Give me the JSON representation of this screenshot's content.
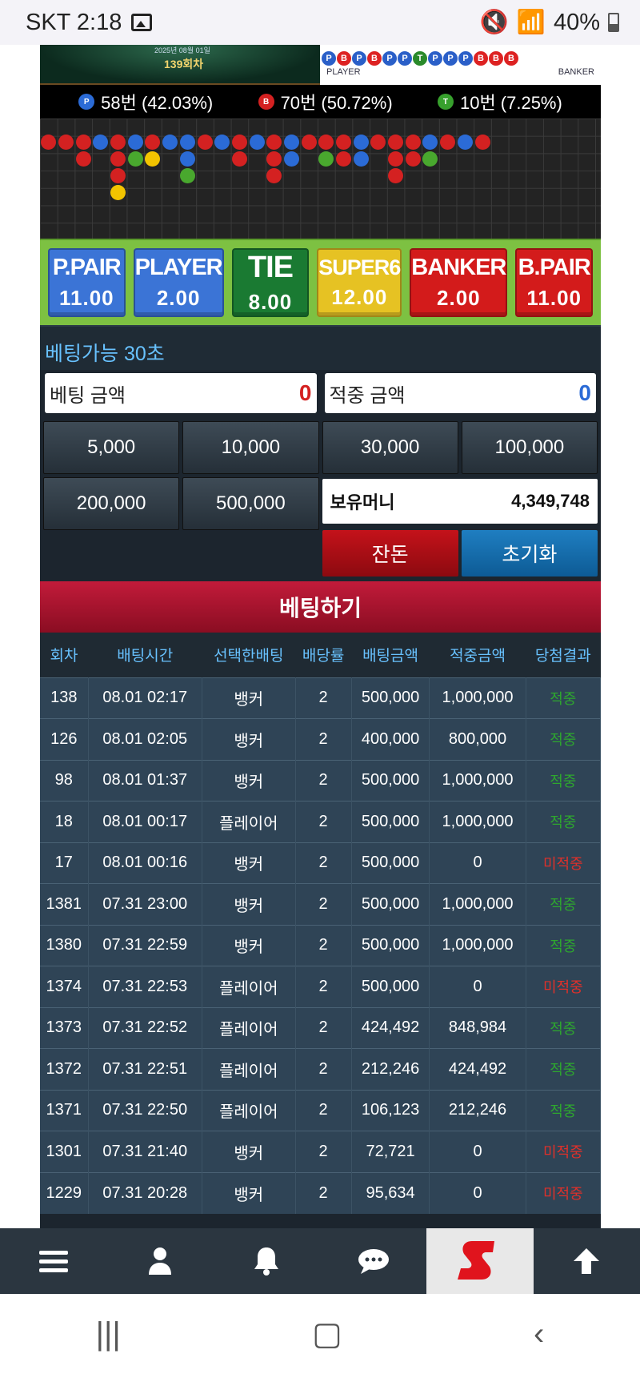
{
  "status": {
    "carrier_time": "SKT 2:18",
    "battery": "40%"
  },
  "game": {
    "date": "2025년 08월 01일",
    "round": "139회차",
    "legend_player": "PLAYER",
    "legend_banker": "BANKER"
  },
  "stats": {
    "p_count": "58번 (42.03%)",
    "b_count": "70번 (50.72%)",
    "t_count": "10번 (7.25%)",
    "p_label": "P",
    "b_label": "B",
    "t_label": "T"
  },
  "board": [
    {
      "name": "P.PAIR",
      "odds": "11.00"
    },
    {
      "name": "PLAYER",
      "odds": "2.00"
    },
    {
      "name": "TIE",
      "odds": "8.00"
    },
    {
      "name": "SUPER6",
      "odds": "12.00"
    },
    {
      "name": "BANKER",
      "odds": "2.00"
    },
    {
      "name": "B.PAIR",
      "odds": "11.00"
    }
  ],
  "bet": {
    "available": "베팅가능 30초",
    "amount_label": "베팅 금액",
    "amount_value": "0",
    "win_label": "적중 금액",
    "win_value": "0",
    "chips": [
      "5,000",
      "10,000",
      "30,000",
      "100,000",
      "200,000",
      "500,000"
    ],
    "money_label": "보유머니",
    "money_value": "4,349,748",
    "change_label": "잔돈",
    "reset_label": "초기화",
    "submit_label": "베팅하기"
  },
  "history": {
    "headers": [
      "회차",
      "배팅시간",
      "선택한배팅",
      "배당률",
      "배팅금액",
      "적중금액",
      "당첨결과"
    ],
    "rows": [
      [
        "138",
        "08.01 02:17",
        "뱅커",
        "2",
        "500,000",
        "1,000,000",
        "적중"
      ],
      [
        "126",
        "08.01 02:05",
        "뱅커",
        "2",
        "400,000",
        "800,000",
        "적중"
      ],
      [
        "98",
        "08.01 01:37",
        "뱅커",
        "2",
        "500,000",
        "1,000,000",
        "적중"
      ],
      [
        "18",
        "08.01 00:17",
        "플레이어",
        "2",
        "500,000",
        "1,000,000",
        "적중"
      ],
      [
        "17",
        "08.01 00:16",
        "뱅커",
        "2",
        "500,000",
        "0",
        "미적중"
      ],
      [
        "1381",
        "07.31 23:00",
        "뱅커",
        "2",
        "500,000",
        "1,000,000",
        "적중"
      ],
      [
        "1380",
        "07.31 22:59",
        "뱅커",
        "2",
        "500,000",
        "1,000,000",
        "적중"
      ],
      [
        "1374",
        "07.31 22:53",
        "플레이어",
        "2",
        "500,000",
        "0",
        "미적중"
      ],
      [
        "1373",
        "07.31 22:52",
        "플레이어",
        "2",
        "424,492",
        "848,984",
        "적중"
      ],
      [
        "1372",
        "07.31 22:51",
        "플레이어",
        "2",
        "212,246",
        "424,492",
        "적중"
      ],
      [
        "1371",
        "07.31 22:50",
        "플레이어",
        "2",
        "106,123",
        "212,246",
        "적중"
      ],
      [
        "1301",
        "07.31 21:40",
        "뱅커",
        "2",
        "72,721",
        "0",
        "미적중"
      ],
      [
        "1229",
        "07.31 20:28",
        "뱅커",
        "2",
        "95,634",
        "0",
        "미적중"
      ]
    ]
  },
  "nav": [
    "menu-icon",
    "user-icon",
    "bell-icon",
    "chat-icon",
    "logo",
    "arrow-up-icon"
  ]
}
